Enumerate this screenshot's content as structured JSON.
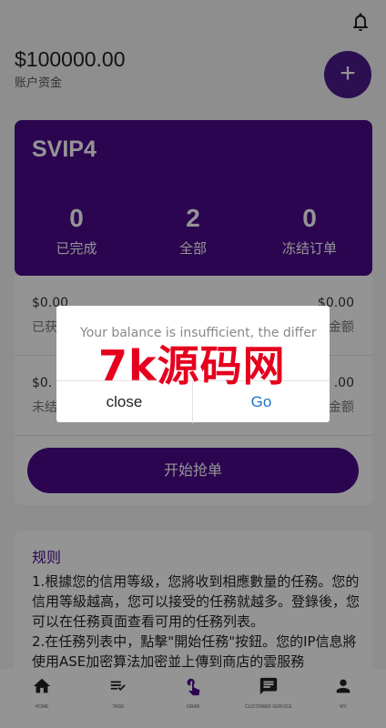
{
  "header": {
    "balance": "$100000.00",
    "balance_label": "账户资金",
    "add_label": "+"
  },
  "vip": {
    "title": "SVIP4",
    "stats": [
      {
        "value": "0",
        "label": "已完成"
      },
      {
        "value": "2",
        "label": "全部"
      },
      {
        "value": "0",
        "label": "冻结订单"
      }
    ]
  },
  "details": {
    "row1": {
      "left_amount": "$0.00",
      "left_label": "已获",
      "right_amount": "$0.00",
      "right_label": "金额"
    },
    "row2": {
      "left_amount": "$0.",
      "left_label": "未结",
      "right_amount": ".00",
      "right_label": "金额"
    },
    "start_button": "开始抢单"
  },
  "rules": {
    "title": "规则",
    "text": "1.根據您的信用等级，您將收到相應數量的任務。您的信用等級越高，您可以接受的任務就越多。登錄後，您可以在任務頁面查看可用的任務列表。\n2.在任務列表中，點擊\"開始任務\"按鈕。您的IP信息將使用ASE加密算法加密並上傳到商店的雲服務"
  },
  "tabbar": {
    "items": [
      {
        "label": "HOME",
        "icon": "home-icon"
      },
      {
        "label": "TASK",
        "icon": "task-list-icon"
      },
      {
        "label": "GRAB",
        "icon": "tap-hand-icon"
      },
      {
        "label": "CUSTOMER SERVICE",
        "icon": "chat-icon"
      },
      {
        "label": "MY",
        "icon": "person-icon"
      }
    ],
    "active_color": "#4b0a8a"
  },
  "dialog": {
    "message": "Your balance is insufficient, the differ",
    "close_label": "close",
    "go_label": "Go"
  },
  "watermark": {
    "text": "7k源码网"
  },
  "colors": {
    "primary": "#4b0a8a",
    "link": "#1a73c8",
    "watermark": "#e6001e"
  }
}
